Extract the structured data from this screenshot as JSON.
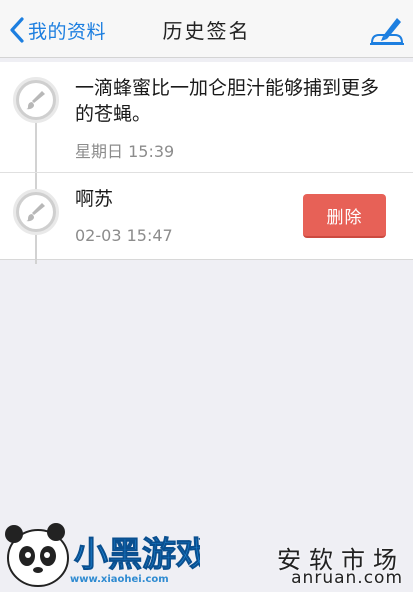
{
  "nav": {
    "back_label": "我的资料",
    "title": "历史签名"
  },
  "signatures": [
    {
      "text": "一滴蜂蜜比一加仑胆汁能够捕到更多的苍蝇。",
      "time": "星期日 15:39"
    },
    {
      "text": "啊苏",
      "time": "02-03 15:47"
    }
  ],
  "actions": {
    "delete_label": "删除"
  },
  "watermarks": {
    "left_site": "www.xiaohei.com",
    "left_brand": "小黑游戏",
    "right_cn": "安软市场",
    "right_en": "anruan.com"
  },
  "colors": {
    "accent": "#1d7fe0",
    "delete": "#e76157"
  },
  "icons": [
    "chevron-left-icon",
    "edit-signature-icon",
    "brush-icon"
  ]
}
